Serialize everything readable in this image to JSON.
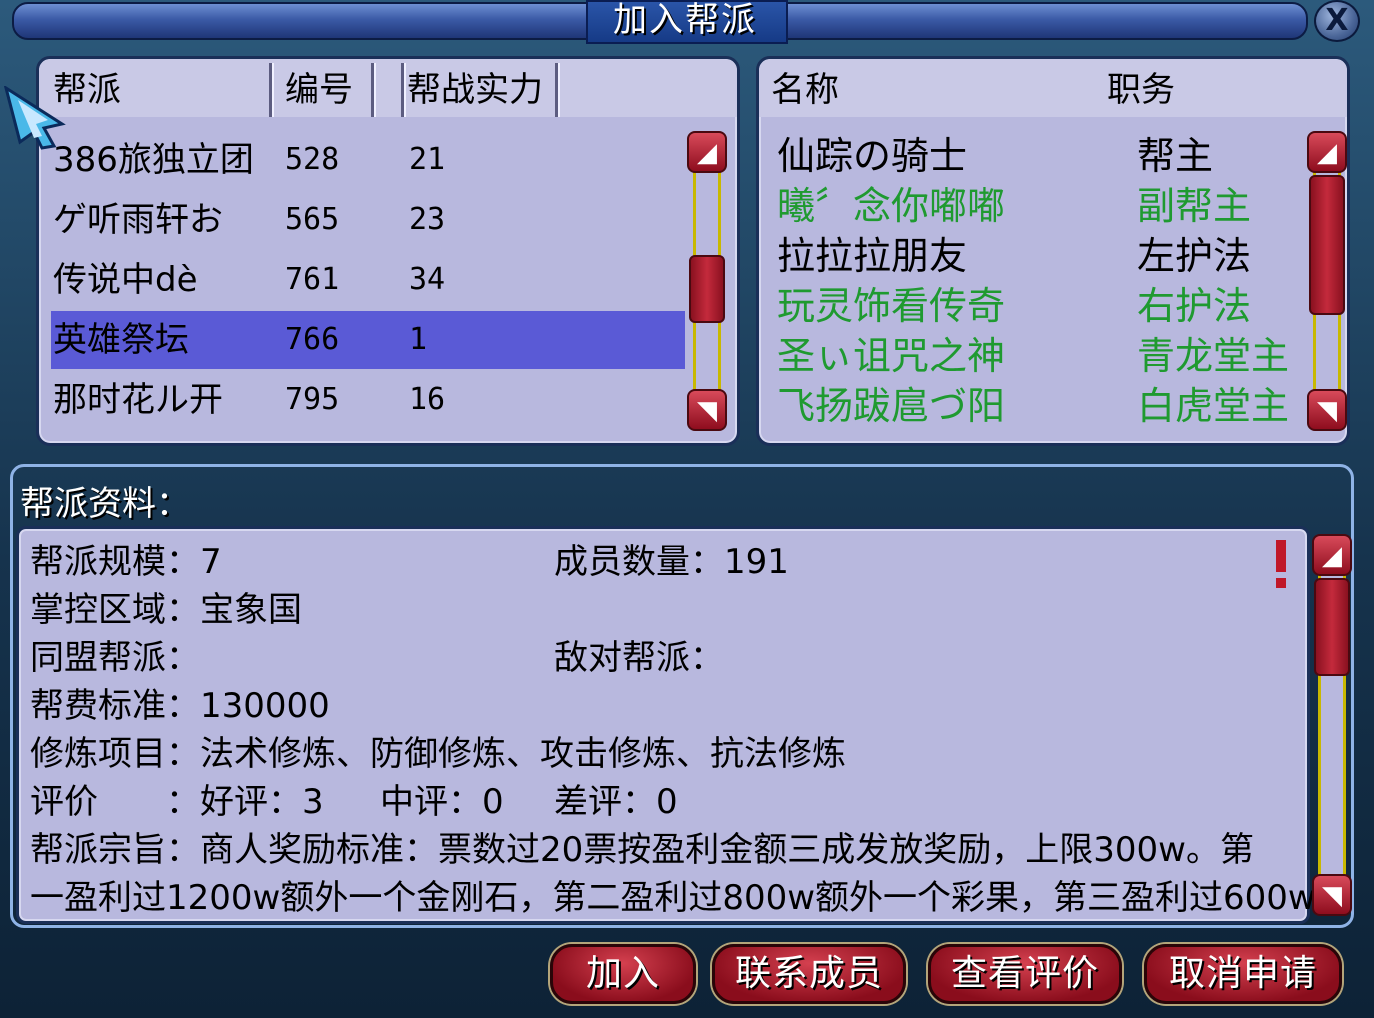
{
  "window": {
    "title": "加入帮派",
    "close_label": "X"
  },
  "guild_list": {
    "headers": [
      "帮派",
      "编号",
      "帮战实力"
    ],
    "rows": [
      {
        "name": "386旅独立团",
        "id": "528",
        "power": "21",
        "selected": false
      },
      {
        "name": "ゲ听雨轩お",
        "id": "565",
        "power": "23",
        "selected": false
      },
      {
        "name": "传说中dè",
        "id": "761",
        "power": "34",
        "selected": false
      },
      {
        "name": "英雄祭坛",
        "id": "766",
        "power": "1",
        "selected": true
      },
      {
        "name": "那时花ル开",
        "id": "795",
        "power": "16",
        "selected": false
      }
    ]
  },
  "member_list": {
    "headers": [
      "名称",
      "职务"
    ],
    "rows": [
      {
        "name": "仙踪の骑士",
        "role": "帮主",
        "color": "#000000"
      },
      {
        "name": "曦〞念你嘟嘟",
        "role": "副帮主",
        "color": "#1f9a30"
      },
      {
        "name": "拉拉拉朋友",
        "role": "左护法",
        "color": "#000000"
      },
      {
        "name": "玩灵饰看传奇",
        "role": "右护法",
        "color": "#1f9a30"
      },
      {
        "name": "圣ぃ诅咒之神",
        "role": "青龙堂主",
        "color": "#1f9a30"
      },
      {
        "name": "飞扬跋扈づ阳",
        "role": "白虎堂主",
        "color": "#1f9a30"
      }
    ]
  },
  "info": {
    "section_title": "帮派资料：",
    "scale": "帮派规模：7",
    "members": "成员数量：191",
    "territory": "掌控区域：宝象国",
    "allies": "同盟帮派：",
    "enemies": "敌对帮派：",
    "fee": "帮费标准：130000",
    "training": "修炼项目：法术修炼、防御修炼、攻击修炼、抗法修炼",
    "rating_label": "评价　　：好评：3",
    "rating_mid": "中评：0",
    "rating_bad": "差评：0",
    "purpose_line1": "帮派宗旨：商人奖励标准：票数过20票按盈利金额三成发放奖励，上限300w。第",
    "purpose_line2": "一盈利过1200w额外一个金刚石，第二盈利过800w额外一个彩果，第三盈利过600w"
  },
  "buttons": {
    "join": "加入",
    "contact": "联系成员",
    "view_rating": "查看评价",
    "cancel_apply": "取消申请"
  },
  "colors": {
    "panel": "#b8b8de",
    "selected_row": "#5a5ad6",
    "officer_green": "#1f9a30",
    "button_red": "#b0202e"
  }
}
